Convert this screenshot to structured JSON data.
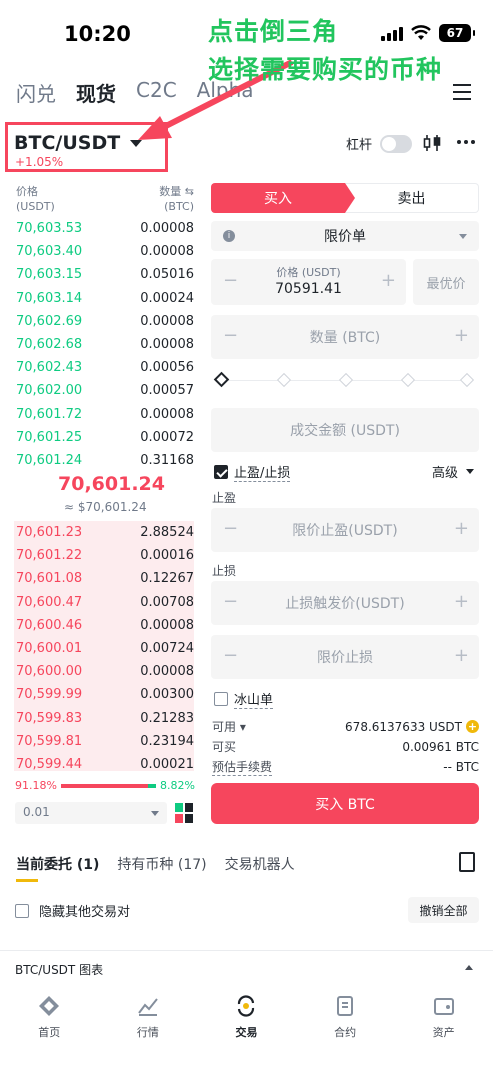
{
  "status": {
    "time": "10:20",
    "battery": "67"
  },
  "annotation": {
    "line1": "点击倒三角",
    "line2": "选择需要购买的币种"
  },
  "top_tabs": [
    {
      "label": "闪兑",
      "active": false
    },
    {
      "label": "现货",
      "active": true
    },
    {
      "label": "C2C",
      "active": false
    },
    {
      "label": "Alpha",
      "active": false
    }
  ],
  "pair": {
    "name": "BTC/USDT",
    "change": "+1.05%"
  },
  "leverage_label": "杠杆",
  "orderbook": {
    "price_label": "价格",
    "price_unit": "(USDT)",
    "qty_label": "数量",
    "qty_unit": "(BTC)",
    "bids": [
      {
        "price": "70,603.53",
        "qty": "0.00008"
      },
      {
        "price": "70,603.40",
        "qty": "0.00008"
      },
      {
        "price": "70,603.15",
        "qty": "0.05016"
      },
      {
        "price": "70,603.14",
        "qty": "0.00024"
      },
      {
        "price": "70,602.69",
        "qty": "0.00008"
      },
      {
        "price": "70,602.68",
        "qty": "0.00008"
      },
      {
        "price": "70,602.43",
        "qty": "0.00056"
      },
      {
        "price": "70,602.00",
        "qty": "0.00057"
      },
      {
        "price": "70,601.72",
        "qty": "0.00008"
      },
      {
        "price": "70,601.25",
        "qty": "0.00072"
      },
      {
        "price": "70,601.24",
        "qty": "0.31168"
      }
    ],
    "mid_price": "70,601.24",
    "mid_sub": "≈ $70,601.24",
    "asks": [
      {
        "price": "70,601.23",
        "qty": "2.88524"
      },
      {
        "price": "70,601.22",
        "qty": "0.00016"
      },
      {
        "price": "70,601.08",
        "qty": "0.12267"
      },
      {
        "price": "70,600.47",
        "qty": "0.00708"
      },
      {
        "price": "70,600.46",
        "qty": "0.00008"
      },
      {
        "price": "70,600.01",
        "qty": "0.00724"
      },
      {
        "price": "70,600.00",
        "qty": "0.00008"
      },
      {
        "price": "70,599.99",
        "qty": "0.00300"
      },
      {
        "price": "70,599.83",
        "qty": "0.21283"
      },
      {
        "price": "70,599.81",
        "qty": "0.23194"
      },
      {
        "price": "70,599.44",
        "qty": "0.00021"
      }
    ],
    "buy_pct": "91.18%",
    "sell_pct": "8.82%",
    "buy_ratio": 0.9118,
    "tick": "0.01"
  },
  "form": {
    "buy_tab": "买入",
    "sell_tab": "卖出",
    "order_type": "限价单",
    "price_label": "价格 (USDT)",
    "price_value": "70591.41",
    "best_price": "最优价",
    "qty_placeholder": "数量 (BTC)",
    "total_placeholder": "成交金额 (USDT)",
    "tpsl_label": "止盈/止损",
    "advanced": "高级",
    "tp_label": "止盈",
    "tp_placeholder": "限价止盈(USDT)",
    "sl_label": "止损",
    "sl_trigger_placeholder": "止损触发价(USDT)",
    "sl_limit_placeholder": "限价止损",
    "iceberg_label": "冰山单",
    "available_label": "可用",
    "available_value": "678.6137633 USDT",
    "can_buy_label": "可买",
    "can_buy_value": "0.00961 BTC",
    "fee_label": "预估手续费",
    "fee_value": "-- BTC",
    "buy_button": "买入 BTC"
  },
  "orders": {
    "tabs": [
      "当前委托 (1)",
      "持有币种 (17)",
      "交易机器人"
    ],
    "hide_pairs": "隐藏其他交易对",
    "cancel_all": "撤销全部"
  },
  "chart_bar_label": "BTC/USDT 图表",
  "nav": [
    {
      "label": "首页",
      "icon": "home-icon"
    },
    {
      "label": "行情",
      "icon": "markets-icon"
    },
    {
      "label": "交易",
      "icon": "trade-icon"
    },
    {
      "label": "合约",
      "icon": "futures-icon"
    },
    {
      "label": "资产",
      "icon": "wallet-icon"
    }
  ],
  "colors": {
    "red": "#f6465d",
    "green": "#0ecb81",
    "yellow": "#f0b90b",
    "annotation": "#22c55e"
  }
}
